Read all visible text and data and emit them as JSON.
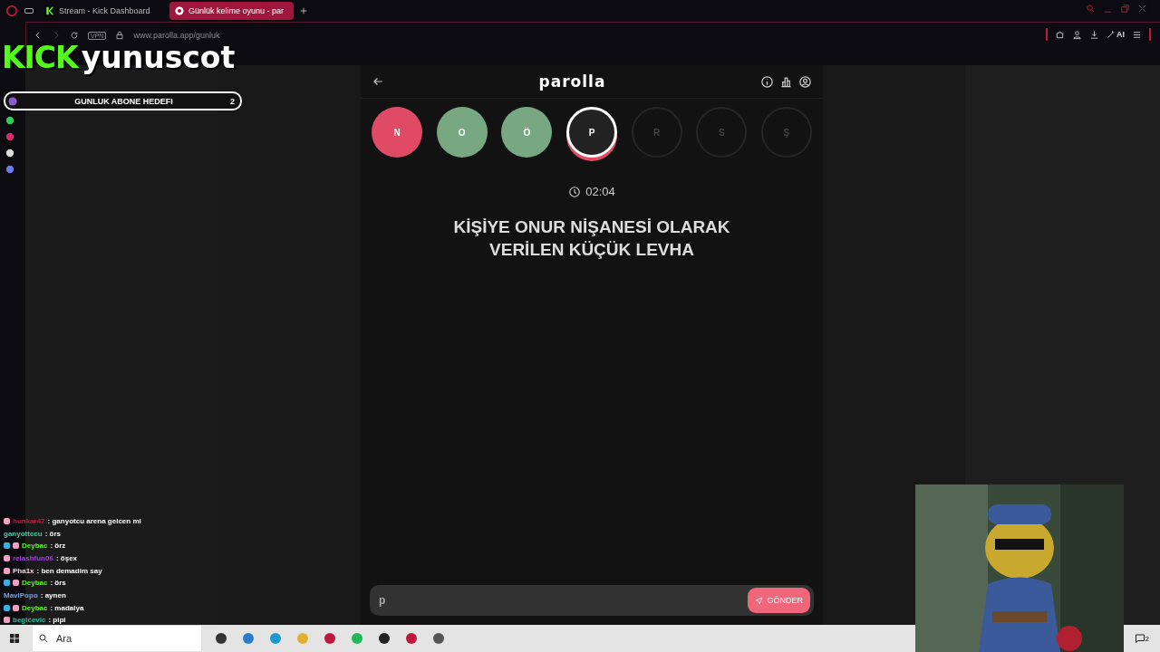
{
  "browser": {
    "tabs": [
      {
        "label": "Stream - Kick Dashboard",
        "selected": false
      },
      {
        "label": "Günlük kelime oyunu - par",
        "selected": true
      }
    ],
    "address": "www.parolla.app/gunluk",
    "vpn_badge": "VPN",
    "ai_label": "AI"
  },
  "overlay": {
    "logo": "KICK",
    "channel": "yunuscot",
    "goal": {
      "label": "GUNLUK ABONE HEDEFI",
      "count": "2"
    }
  },
  "game": {
    "title": "parolla",
    "letters": [
      {
        "letter": "N",
        "current": false,
        "answered": true,
        "correct": false
      },
      {
        "letter": "O",
        "current": false,
        "answered": true,
        "correct": true
      },
      {
        "letter": "Ö",
        "current": false,
        "answered": true,
        "correct": true
      },
      {
        "letter": "P",
        "current": true,
        "answered": false
      },
      {
        "letter": "R",
        "current": false,
        "answered": false
      },
      {
        "letter": "S",
        "current": false,
        "answered": false
      },
      {
        "letter": "Ş",
        "current": false,
        "answered": false
      }
    ],
    "timer": "02:04",
    "question": "KİŞİYE ONUR NİŞANESİ OLARAK VERİLEN KÜÇÜK LEVHA",
    "answer": {
      "value": "p"
    },
    "submit": "GÖNDER"
  },
  "chat": [
    {
      "user": "hunkar47",
      "color": "#c0183c",
      "text": ": ganyotcu arena gelcen mi",
      "gifter": false,
      "subscriber": true
    },
    {
      "user": "ganyottccu",
      "color": "#4ec9a0",
      "text": ": örs",
      "gifter": false,
      "subscriber": false
    },
    {
      "user": "Deybac",
      "color": "#53fc18",
      "text": ": örz",
      "gifter": true,
      "subscriber": true
    },
    {
      "user": "relashfun06",
      "color": "#a040e0",
      "text": ": öşex",
      "gifter": false,
      "subscriber": true
    },
    {
      "user": "Pha1x",
      "color": "#f0d8e0",
      "text": ": ben demadim say",
      "gifter": false,
      "subscriber": true
    },
    {
      "user": "Deybac",
      "color": "#53fc18",
      "text": ": örs",
      "gifter": true,
      "subscriber": true
    },
    {
      "user": "MaviPopo",
      "color": "#7aa0e0",
      "text": ": aynen",
      "gifter": false,
      "subscriber": false
    },
    {
      "user": "Deybac",
      "color": "#53fc18",
      "text": ": madalya",
      "gifter": true,
      "subscriber": true
    },
    {
      "user": "begicevic",
      "color": "#2ec0a0",
      "text": ": pipi",
      "gifter": false,
      "subscriber": true
    }
  ],
  "taskbar": {
    "search": "Ara",
    "notifications": "2"
  }
}
